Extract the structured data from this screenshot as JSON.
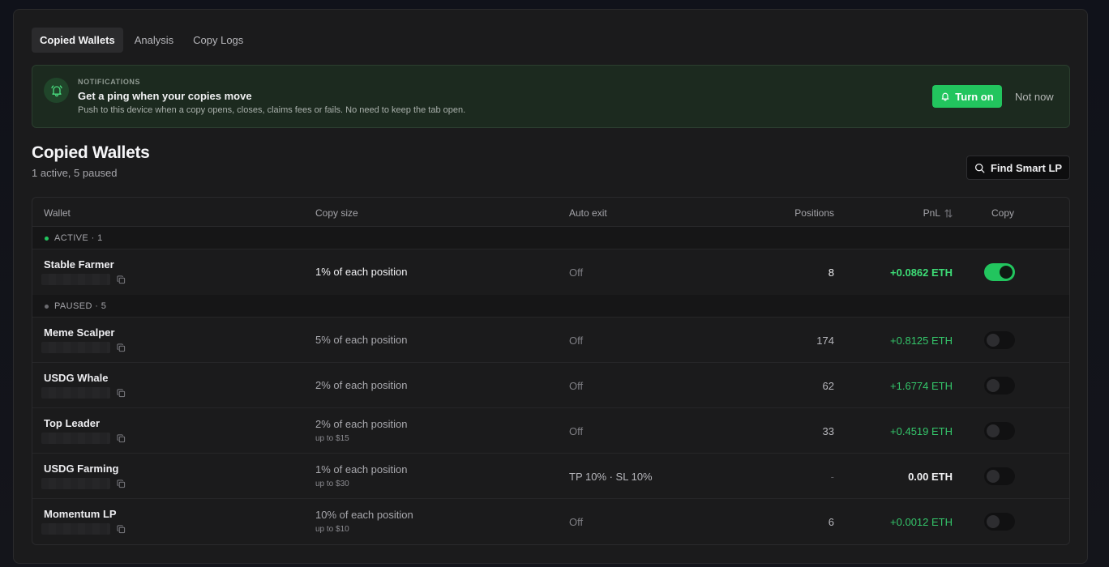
{
  "tabs": [
    {
      "label": "Copied Wallets",
      "active": true
    },
    {
      "label": "Analysis",
      "active": false
    },
    {
      "label": "Copy Logs",
      "active": false
    }
  ],
  "notification": {
    "eyebrow": "NOTIFICATIONS",
    "headline": "Get a ping when your copies move",
    "description": "Push to this device when a copy opens, closes, claims fees or fails. No need to keep the tab open.",
    "turn_on_label": "Turn on",
    "not_now_label": "Not now",
    "icon": "bell-icon"
  },
  "header": {
    "title": "Copied Wallets",
    "subtitle": "1 active, 5 paused",
    "find_button_label": "Find Smart LP",
    "find_icon": "search-icon"
  },
  "table": {
    "columns": {
      "wallet": "Wallet",
      "copy_size": "Copy size",
      "auto_exit": "Auto exit",
      "positions": "Positions",
      "pnl": "PnL",
      "copy": "Copy"
    },
    "sort_icon": "sort-arrows-icon",
    "active_group": {
      "label": "ACTIVE · 1",
      "dot_color": "#22c55e",
      "rows": [
        {
          "name": "Stable Farmer",
          "copy_size": "1% of each position",
          "cap": "",
          "auto_exit": "Off",
          "positions": "8",
          "pnl": "+0.0862 ETH",
          "enabled": true
        }
      ]
    },
    "paused_group": {
      "label": "PAUSED · 5",
      "dot_color": "#6b6b70",
      "rows": [
        {
          "name": "Meme Scalper",
          "copy_size": "5% of each position",
          "cap": "",
          "auto_exit": "Off",
          "positions": "174",
          "pnl": "+0.8125 ETH",
          "enabled": false
        },
        {
          "name": "USDG Whale",
          "copy_size": "2% of each position",
          "cap": "",
          "auto_exit": "Off",
          "positions": "62",
          "pnl": "+1.6774 ETH",
          "enabled": false
        },
        {
          "name": "Top Leader",
          "copy_size": "2% of each position",
          "cap": "up to $15",
          "auto_exit": "Off",
          "positions": "33",
          "pnl": "+0.4519 ETH",
          "enabled": false
        },
        {
          "name": "USDG Farming",
          "copy_size": "1% of each position",
          "cap": "up to $30",
          "auto_exit": "TP 10% · SL 10%",
          "positions": "-",
          "pnl": "0.00 ETH",
          "enabled": false
        },
        {
          "name": "Momentum LP",
          "copy_size": "10% of each position",
          "cap": "up to $10",
          "auto_exit": "Off",
          "positions": "6",
          "pnl": "+0.0012 ETH",
          "enabled": false
        }
      ]
    }
  },
  "colors": {
    "accent_green": "#22c55e",
    "pnl_green": "#34c56a",
    "panel_bg": "#1b1b1c",
    "banner_bg": "#1c2a1f"
  }
}
